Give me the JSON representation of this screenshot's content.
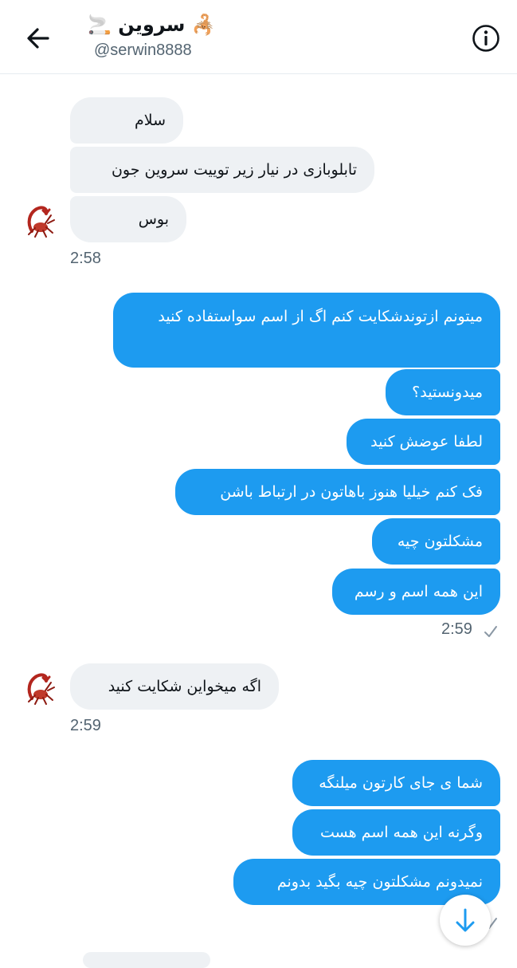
{
  "header": {
    "title": "🦂 سروین 🚬",
    "handle": "@serwin8888"
  },
  "messages": {
    "m1": "سلام",
    "m2": "تابلوبازی در نیار زیر توییت سروین جون",
    "m3": "بوس",
    "t1": "2:58",
    "o1": "میتونم ازتوندشکایت کنم اگ از اسم سواستفاده کنید",
    "o2": "میدونستید؟",
    "o3": "لطفا عوضش کنید",
    "o4": "فک کنم خیلیا هنوز باهاتون در ارتباط باشن",
    "o5": "مشکلتون چیه",
    "o6": "این همه اسم و رسم",
    "t2": "2:59",
    "m4": "اگه میخواین شکایت کنید",
    "t3": "2:59",
    "o7": "شما ی جای کارتون میلنگه",
    "o8": "وگرنه این همه اسم هست",
    "o9": "نمیدونم مشکلتون چیه بگید بدونم"
  },
  "colors": {
    "outgoing": "#1d9bf0",
    "incoming": "#eef1f4",
    "avatar_accent": "#b3261e"
  },
  "icons": {
    "back": "arrow-left-icon",
    "info": "info-icon",
    "read": "checkmark-icon",
    "scroll": "arrow-down-icon",
    "avatar": "scorpion-avatar"
  }
}
